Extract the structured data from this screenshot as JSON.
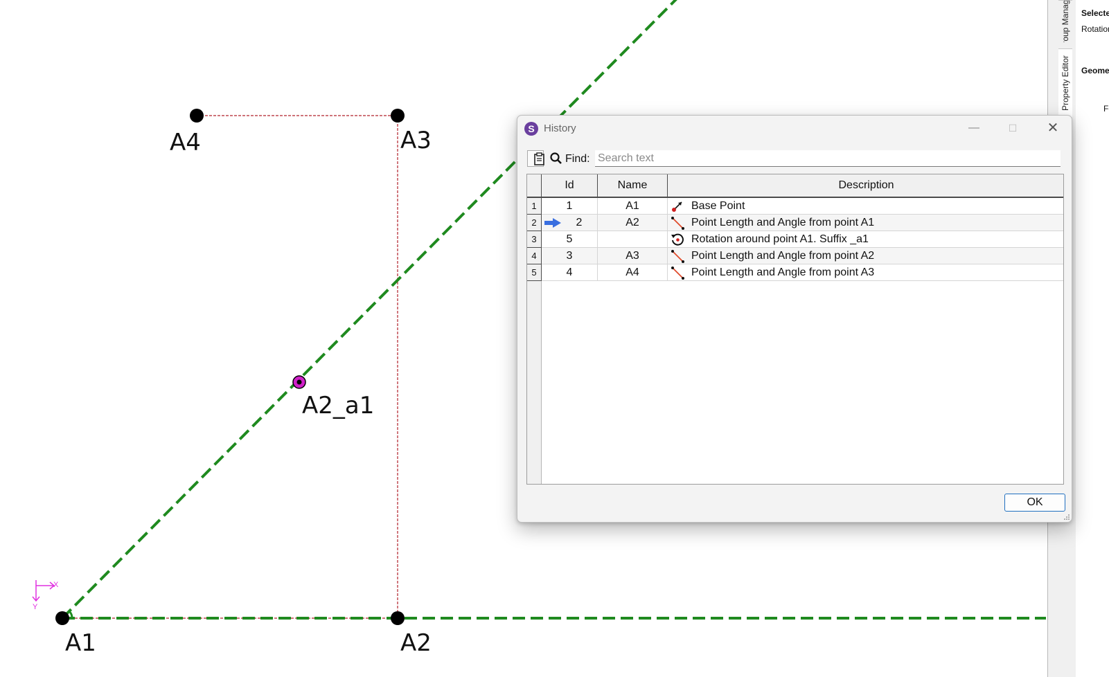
{
  "canvas": {
    "points": [
      {
        "label": "A1",
        "kind": "base"
      },
      {
        "label": "A2",
        "kind": "point"
      },
      {
        "label": "A3",
        "kind": "point"
      },
      {
        "label": "A4",
        "kind": "point"
      },
      {
        "label": "A2_a1",
        "kind": "rotated"
      }
    ],
    "axes": {
      "x_label": "X",
      "y_label": "Y"
    },
    "colors": {
      "guide_line": "#1f8a1f",
      "construction_line": "#b0202a",
      "point": "#000000",
      "rotated_point": "#d020c8",
      "axis_indicator": "#e030e0"
    }
  },
  "dock": {
    "tabs": [
      "Group Manager",
      "Property Editor"
    ],
    "panel_labels": [
      "Selected",
      "Rotation",
      "Geometry",
      "Fo"
    ]
  },
  "dialog": {
    "title": "History",
    "find_label": "Find:",
    "search": {
      "placeholder": "Search text",
      "value": ""
    },
    "columns": [
      "Id",
      "Name",
      "Description"
    ],
    "rows": [
      {
        "row": "1",
        "id": "1",
        "name": "A1",
        "description": "Base Point",
        "icon": "base-point-icon",
        "current": false
      },
      {
        "row": "2",
        "id": "2",
        "name": "A2",
        "description": "Point Length and Angle from point A1",
        "icon": "length-angle-icon",
        "current": true
      },
      {
        "row": "3",
        "id": "5",
        "name": "",
        "description": "Rotation around point A1. Suffix _a1",
        "icon": "rotation-icon",
        "current": false
      },
      {
        "row": "4",
        "id": "3",
        "name": "A3",
        "description": "Point Length and Angle from point A2",
        "icon": "length-angle-icon",
        "current": false
      },
      {
        "row": "5",
        "id": "4",
        "name": "A4",
        "description": "Point Length and Angle from point A3",
        "icon": "length-angle-icon",
        "current": false
      }
    ],
    "ok_label": "OK"
  }
}
